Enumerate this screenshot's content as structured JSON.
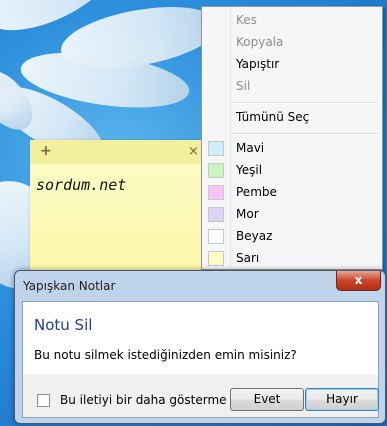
{
  "sticky_note": {
    "add_glyph": "+",
    "close_glyph": "×",
    "text": "sordum.net"
  },
  "context_menu": {
    "items": [
      {
        "label": "Kes",
        "enabled": false
      },
      {
        "label": "Kopyala",
        "enabled": false
      },
      {
        "label": "Yapıştır",
        "enabled": true
      },
      {
        "label": "Sil",
        "enabled": false
      },
      {
        "label": "Tümünü Seç",
        "enabled": true
      }
    ],
    "colors": [
      {
        "label": "Mavi",
        "color": "#cdeffc"
      },
      {
        "label": "Yeşil",
        "color": "#c9f7bd"
      },
      {
        "label": "Pembe",
        "color": "#f5c6f5"
      },
      {
        "label": "Mor",
        "color": "#ddd3f6"
      },
      {
        "label": "Beyaz",
        "color": "#ffffff"
      },
      {
        "label": "Sarı",
        "color": "#fdfcc4"
      }
    ]
  },
  "dialog": {
    "title": "Yapışkan Notlar",
    "close_glyph": "x",
    "heading": "Notu Sil",
    "message": "Bu notu silmek istediğinizden emin misiniz?",
    "checkbox_label": "Bu iletiyi bir daha gösterme",
    "checkbox_checked": false,
    "buttons": {
      "yes": "Evet",
      "no": "Hayır"
    }
  }
}
